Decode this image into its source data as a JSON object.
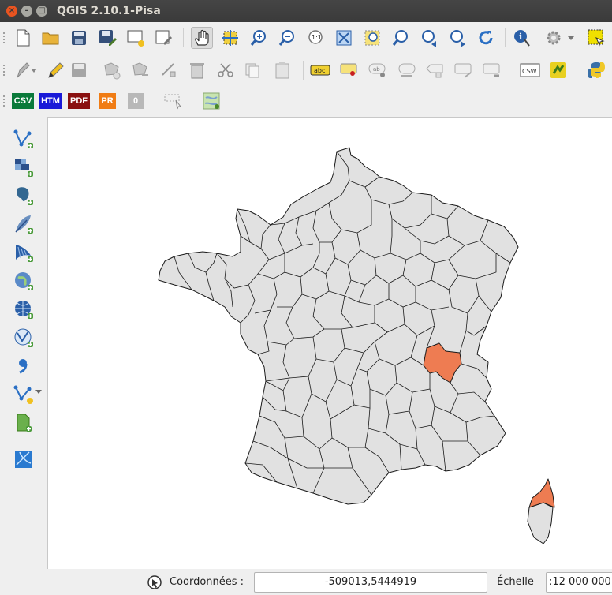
{
  "window": {
    "title": "QGIS 2.10.1-Pisa",
    "close_glyph": "×",
    "min_glyph": "–",
    "max_glyph": "□"
  },
  "toolbar3": {
    "csv_label": "CSV",
    "htm_label": "HTM",
    "pdf_label": "PDF",
    "pr_label": "PR",
    "zero_label": "0"
  },
  "toolbar2": {
    "abc_label": "abc",
    "ab_label": "ab",
    "csw_label": "CSW"
  },
  "statusbar": {
    "coord_label": "Coordonnées :",
    "coord_value": "-509013,5444919",
    "scale_label": "Échelle",
    "scale_value": ":12 000 000"
  },
  "map": {
    "base_fill": "#e1e1e1",
    "highlight_fill": "#ee7c52",
    "border_color": "#1a1a1a"
  },
  "colors": {
    "titlebar": "#3c3c3c",
    "toolbar_bg": "#efefef",
    "csv_badge": "#0a7a3a",
    "htm_badge": "#1a1ad8",
    "pdf_badge": "#8a1010",
    "pr_badge": "#f07c14",
    "zero_badge": "#b8b8b8"
  }
}
